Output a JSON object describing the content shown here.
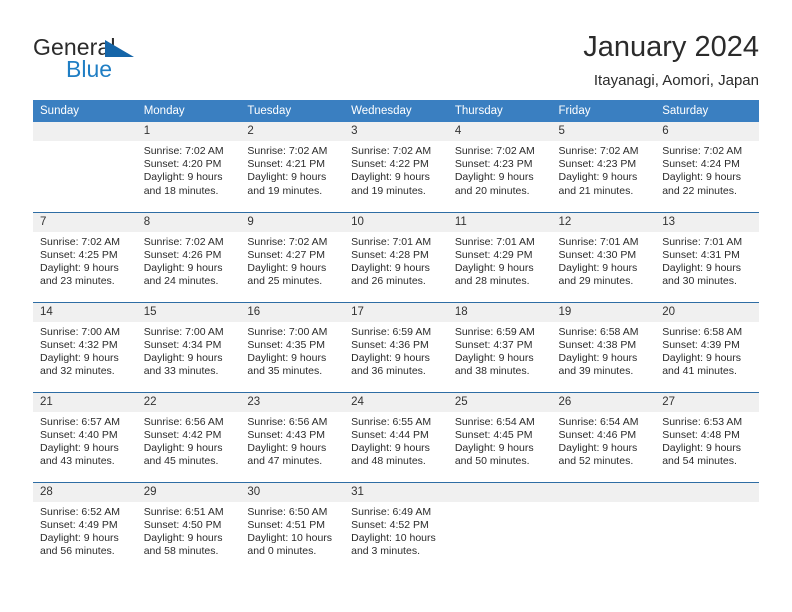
{
  "brand": {
    "name_part1": "General",
    "name_part2": "Blue",
    "logo_icon": "triangle-flag-icon"
  },
  "header": {
    "title": "January 2024",
    "location": "Itayanagi, Aomori, Japan"
  },
  "colors": {
    "header_blue": "#3a7fc1",
    "row_border_blue": "#2e6da4",
    "daynum_band": "#f0f0f0",
    "brand_blue": "#1f7ec4",
    "logo_blue": "#1565a8",
    "text": "#2b2b2b"
  },
  "weekday_headers": [
    "Sunday",
    "Monday",
    "Tuesday",
    "Wednesday",
    "Thursday",
    "Friday",
    "Saturday"
  ],
  "labels": {
    "sunrise_prefix": "Sunrise:",
    "sunset_prefix": "Sunset:",
    "daylight_prefix": "Daylight:"
  },
  "weeks": [
    [
      {
        "blank": true
      },
      {
        "day": "1",
        "sunrise": "Sunrise: 7:02 AM",
        "sunset": "Sunset: 4:20 PM",
        "daylight": "Daylight: 9 hours and 18 minutes."
      },
      {
        "day": "2",
        "sunrise": "Sunrise: 7:02 AM",
        "sunset": "Sunset: 4:21 PM",
        "daylight": "Daylight: 9 hours and 19 minutes."
      },
      {
        "day": "3",
        "sunrise": "Sunrise: 7:02 AM",
        "sunset": "Sunset: 4:22 PM",
        "daylight": "Daylight: 9 hours and 19 minutes."
      },
      {
        "day": "4",
        "sunrise": "Sunrise: 7:02 AM",
        "sunset": "Sunset: 4:23 PM",
        "daylight": "Daylight: 9 hours and 20 minutes."
      },
      {
        "day": "5",
        "sunrise": "Sunrise: 7:02 AM",
        "sunset": "Sunset: 4:23 PM",
        "daylight": "Daylight: 9 hours and 21 minutes."
      },
      {
        "day": "6",
        "sunrise": "Sunrise: 7:02 AM",
        "sunset": "Sunset: 4:24 PM",
        "daylight": "Daylight: 9 hours and 22 minutes."
      }
    ],
    [
      {
        "day": "7",
        "sunrise": "Sunrise: 7:02 AM",
        "sunset": "Sunset: 4:25 PM",
        "daylight": "Daylight: 9 hours and 23 minutes."
      },
      {
        "day": "8",
        "sunrise": "Sunrise: 7:02 AM",
        "sunset": "Sunset: 4:26 PM",
        "daylight": "Daylight: 9 hours and 24 minutes."
      },
      {
        "day": "9",
        "sunrise": "Sunrise: 7:02 AM",
        "sunset": "Sunset: 4:27 PM",
        "daylight": "Daylight: 9 hours and 25 minutes."
      },
      {
        "day": "10",
        "sunrise": "Sunrise: 7:01 AM",
        "sunset": "Sunset: 4:28 PM",
        "daylight": "Daylight: 9 hours and 26 minutes."
      },
      {
        "day": "11",
        "sunrise": "Sunrise: 7:01 AM",
        "sunset": "Sunset: 4:29 PM",
        "daylight": "Daylight: 9 hours and 28 minutes."
      },
      {
        "day": "12",
        "sunrise": "Sunrise: 7:01 AM",
        "sunset": "Sunset: 4:30 PM",
        "daylight": "Daylight: 9 hours and 29 minutes."
      },
      {
        "day": "13",
        "sunrise": "Sunrise: 7:01 AM",
        "sunset": "Sunset: 4:31 PM",
        "daylight": "Daylight: 9 hours and 30 minutes."
      }
    ],
    [
      {
        "day": "14",
        "sunrise": "Sunrise: 7:00 AM",
        "sunset": "Sunset: 4:32 PM",
        "daylight": "Daylight: 9 hours and 32 minutes."
      },
      {
        "day": "15",
        "sunrise": "Sunrise: 7:00 AM",
        "sunset": "Sunset: 4:34 PM",
        "daylight": "Daylight: 9 hours and 33 minutes."
      },
      {
        "day": "16",
        "sunrise": "Sunrise: 7:00 AM",
        "sunset": "Sunset: 4:35 PM",
        "daylight": "Daylight: 9 hours and 35 minutes."
      },
      {
        "day": "17",
        "sunrise": "Sunrise: 6:59 AM",
        "sunset": "Sunset: 4:36 PM",
        "daylight": "Daylight: 9 hours and 36 minutes."
      },
      {
        "day": "18",
        "sunrise": "Sunrise: 6:59 AM",
        "sunset": "Sunset: 4:37 PM",
        "daylight": "Daylight: 9 hours and 38 minutes."
      },
      {
        "day": "19",
        "sunrise": "Sunrise: 6:58 AM",
        "sunset": "Sunset: 4:38 PM",
        "daylight": "Daylight: 9 hours and 39 minutes."
      },
      {
        "day": "20",
        "sunrise": "Sunrise: 6:58 AM",
        "sunset": "Sunset: 4:39 PM",
        "daylight": "Daylight: 9 hours and 41 minutes."
      }
    ],
    [
      {
        "day": "21",
        "sunrise": "Sunrise: 6:57 AM",
        "sunset": "Sunset: 4:40 PM",
        "daylight": "Daylight: 9 hours and 43 minutes."
      },
      {
        "day": "22",
        "sunrise": "Sunrise: 6:56 AM",
        "sunset": "Sunset: 4:42 PM",
        "daylight": "Daylight: 9 hours and 45 minutes."
      },
      {
        "day": "23",
        "sunrise": "Sunrise: 6:56 AM",
        "sunset": "Sunset: 4:43 PM",
        "daylight": "Daylight: 9 hours and 47 minutes."
      },
      {
        "day": "24",
        "sunrise": "Sunrise: 6:55 AM",
        "sunset": "Sunset: 4:44 PM",
        "daylight": "Daylight: 9 hours and 48 minutes."
      },
      {
        "day": "25",
        "sunrise": "Sunrise: 6:54 AM",
        "sunset": "Sunset: 4:45 PM",
        "daylight": "Daylight: 9 hours and 50 minutes."
      },
      {
        "day": "26",
        "sunrise": "Sunrise: 6:54 AM",
        "sunset": "Sunset: 4:46 PM",
        "daylight": "Daylight: 9 hours and 52 minutes."
      },
      {
        "day": "27",
        "sunrise": "Sunrise: 6:53 AM",
        "sunset": "Sunset: 4:48 PM",
        "daylight": "Daylight: 9 hours and 54 minutes."
      }
    ],
    [
      {
        "day": "28",
        "sunrise": "Sunrise: 6:52 AM",
        "sunset": "Sunset: 4:49 PM",
        "daylight": "Daylight: 9 hours and 56 minutes."
      },
      {
        "day": "29",
        "sunrise": "Sunrise: 6:51 AM",
        "sunset": "Sunset: 4:50 PM",
        "daylight": "Daylight: 9 hours and 58 minutes."
      },
      {
        "day": "30",
        "sunrise": "Sunrise: 6:50 AM",
        "sunset": "Sunset: 4:51 PM",
        "daylight": "Daylight: 10 hours and 0 minutes."
      },
      {
        "day": "31",
        "sunrise": "Sunrise: 6:49 AM",
        "sunset": "Sunset: 4:52 PM",
        "daylight": "Daylight: 10 hours and 3 minutes."
      },
      {
        "blank": true
      },
      {
        "blank": true
      },
      {
        "blank": true
      }
    ]
  ]
}
